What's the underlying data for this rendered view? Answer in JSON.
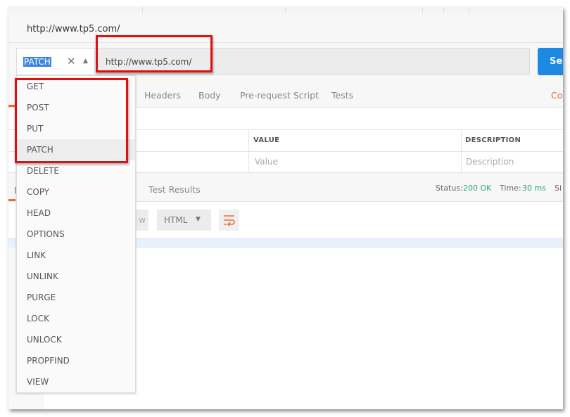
{
  "window_title": "http://www.tp5.com/",
  "request": {
    "method": "PATCH",
    "url": "http://www.tp5.com/",
    "send_label": "Se"
  },
  "request_tabs": [
    "Headers",
    "Body",
    "Pre-request Script",
    "Tests"
  ],
  "request_tabs_right": "Co",
  "params_table": {
    "headers": [
      "VALUE",
      "DESCRIPTION"
    ],
    "placeholders": [
      "Value",
      "Description"
    ]
  },
  "response": {
    "left_tab_fragment": "B",
    "tab": "Test Results",
    "status_label": "Status:",
    "status_value": "200 OK",
    "time_label": "Time:",
    "time_value": "30 ms",
    "size_fragment": "Si",
    "preview_fragment": "w",
    "format": "HTML"
  },
  "method_options": [
    "GET",
    "POST",
    "PUT",
    "PATCH",
    "DELETE",
    "COPY",
    "HEAD",
    "OPTIONS",
    "LINK",
    "UNLINK",
    "PURGE",
    "LOCK",
    "UNLOCK",
    "PROPFIND",
    "VIEW"
  ],
  "selected_method_index": 3,
  "colors": {
    "accent": "#f06a35",
    "send": "#1e88e5",
    "status_ok": "#26a96c",
    "highlight": "#e01010"
  }
}
